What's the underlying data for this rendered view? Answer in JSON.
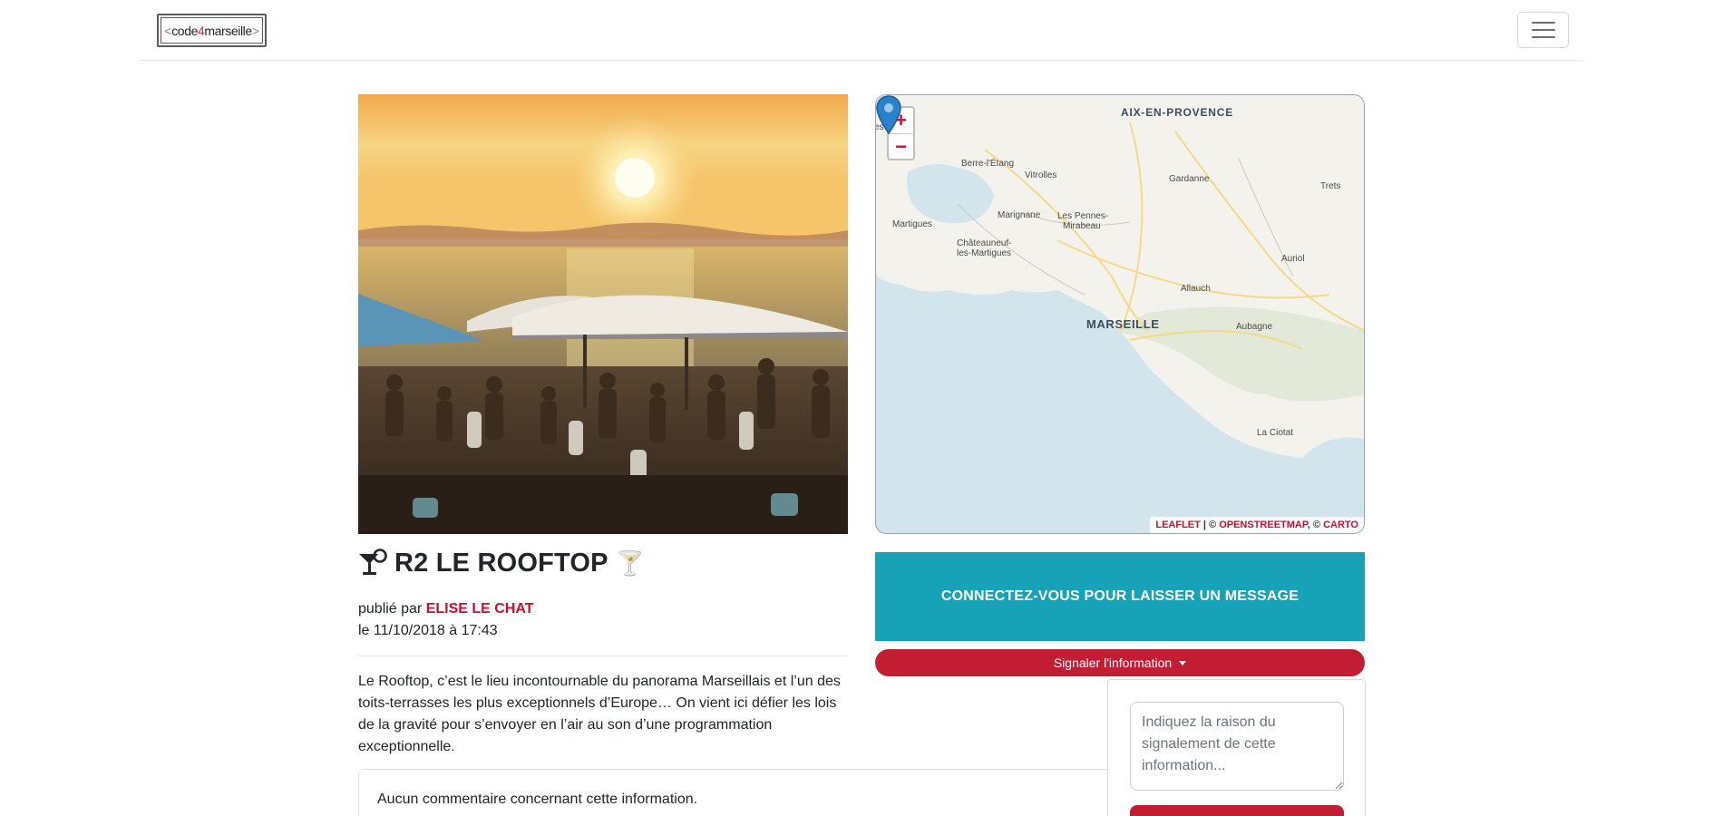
{
  "navbar": {
    "logo": {
      "open": "<",
      "code": "code",
      "four": "4",
      "city": "marseille",
      "close": ">"
    },
    "toggle_icon": "hamburger-icon"
  },
  "photo": {
    "alt": "rooftop-sunset-photo"
  },
  "map": {
    "zoom_in": "+",
    "zoom_out": "−",
    "labels": {
      "aix": "AIX-EN-PROVENCE",
      "berre": "Berre-l'Étang",
      "vitrolles": "Vitrolles",
      "gardanne": "Gardanne",
      "trets": "Trets",
      "martigues": "Martigues",
      "marignane": "Marignane",
      "pennes": "Les Pennes-",
      "mirabeau": "Mirabeau",
      "chateauneuf": "Châteauneuf-",
      "les_martigues": "les-Martigues",
      "auriol": "Auriol",
      "allauch": "Allauch",
      "marseille": "MARSEILLE",
      "aubagne": "Aubagne",
      "laciotat": "La Ciotat",
      "es": "es"
    },
    "attribution": {
      "leaflet": "Leaflet",
      "sep1": " | © ",
      "osm": "OpenStreetMap",
      "sep2": ", © ",
      "carto": "CARTO"
    },
    "colors": {
      "sea": "#d2e4ec",
      "land": "#f4f2ec",
      "road": "#f5d98a",
      "pin": "#2a81cb"
    }
  },
  "post": {
    "title": "R2 LE ROOFTOP",
    "icon_left": "cocktail-icon",
    "icon_right": "🍸",
    "published_by_prefix": "publié par ",
    "author": "ELISE LE CHAT",
    "date_line": "le 11/10/2018 à 17:43",
    "description": "Le Rooftop, c’est le lieu incontournable du panorama Marseillais et l’un des toits-terrasses les plus exceptionnels d’Europe… On vient ici défier les lois de la gravité pour s’envoyer en l’air au son d’une programmation exceptionnelle."
  },
  "comments": {
    "empty_text": "Aucun commentaire concernant cette information."
  },
  "actions": {
    "connect_label": "CONNECTEZ-VOUS POUR LAISSER UN MESSAGE",
    "report_label": "Signaler l'information",
    "report_placeholder": "Indiquez la raison du signalement de cette information..."
  },
  "colors": {
    "accent_red": "#c21d33",
    "info_teal": "#17a2b8"
  }
}
